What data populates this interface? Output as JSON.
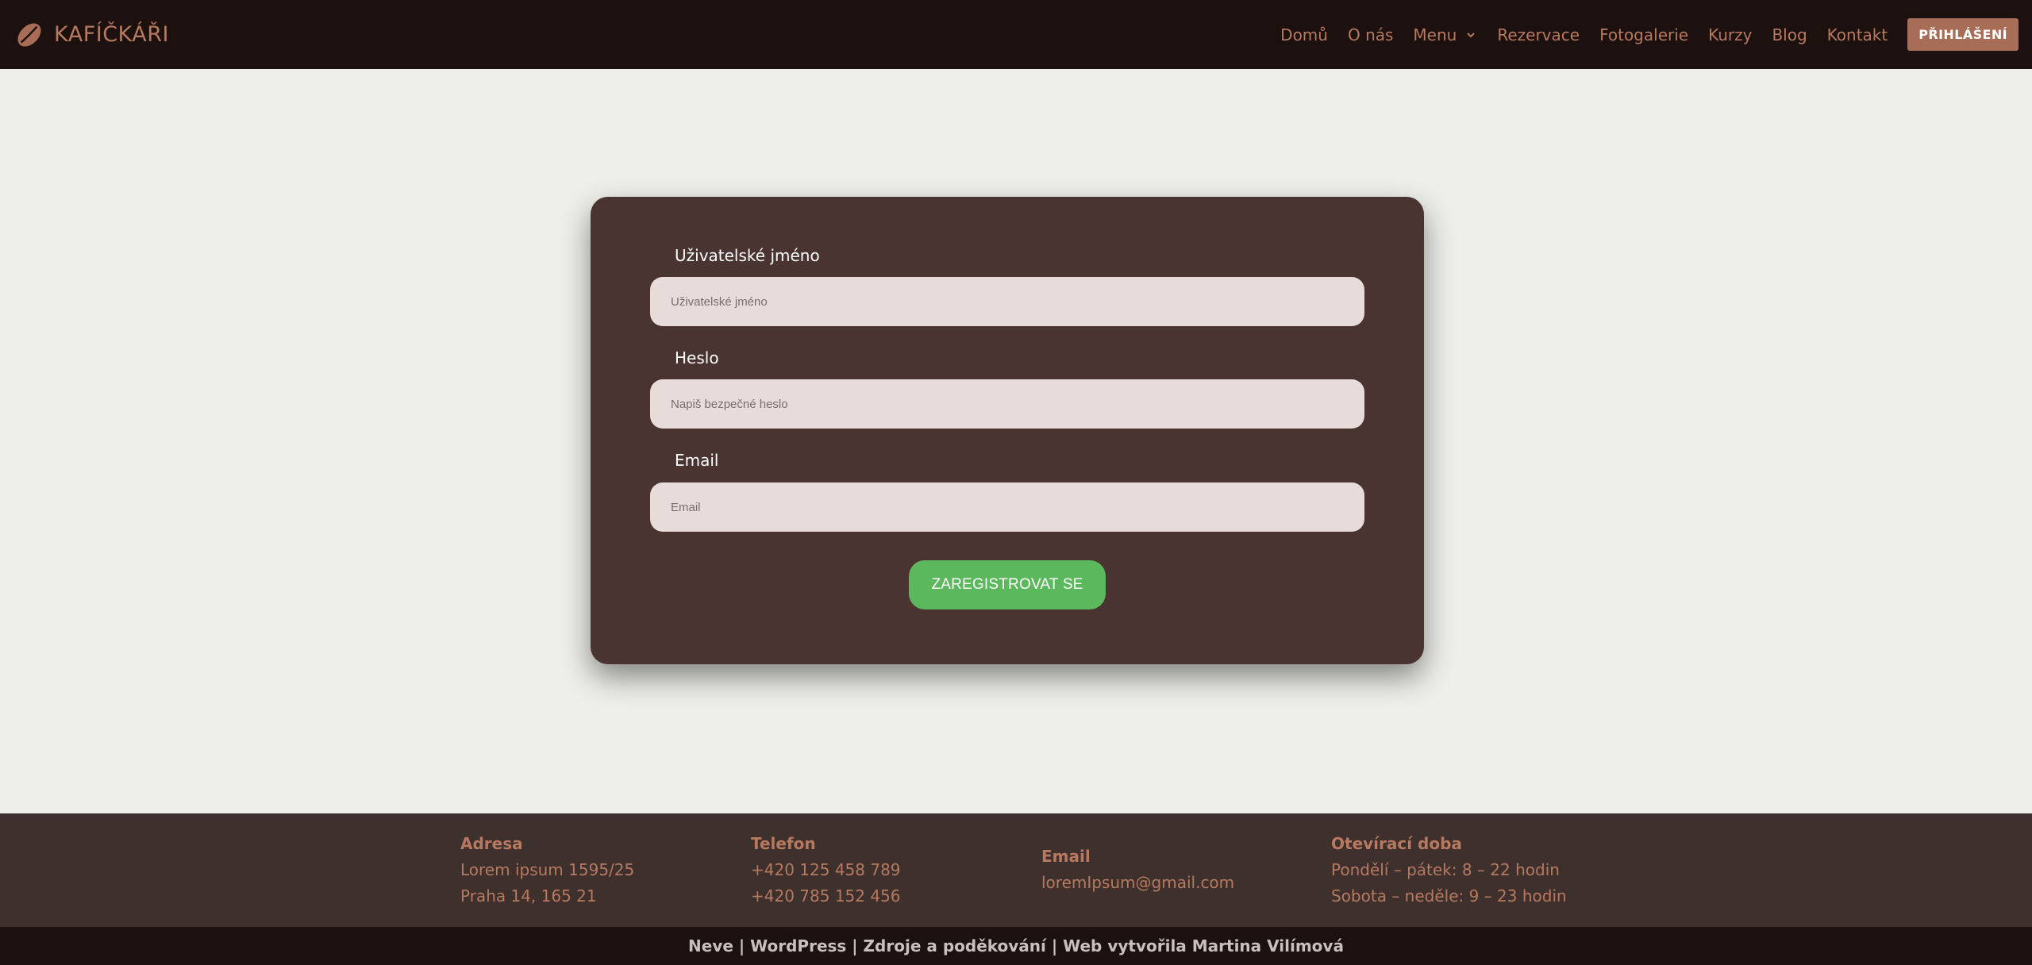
{
  "brand": {
    "name": "KAFÍČKÁŘI"
  },
  "nav": {
    "items": [
      "Domů",
      "O nás",
      "Menu",
      "Rezervace",
      "Fotogalerie",
      "Kurzy",
      "Blog",
      "Kontakt"
    ],
    "login_label": "PŘIHLÁŠENÍ"
  },
  "form": {
    "username_label": "Uživatelské jméno",
    "username_placeholder": "Uživatelské jméno",
    "password_label": "Heslo",
    "password_placeholder": "Napiš bezpečné heslo",
    "email_label": "Email",
    "email_placeholder": "Email",
    "submit_label": "ZAREGISTROVAT SE"
  },
  "footer": {
    "address_title": "Adresa",
    "address_line1": "Lorem ipsum 1595/25",
    "address_line2": "Praha 14, 165 21",
    "phone_title": "Telefon",
    "phone_line1": "+420 125 458 789",
    "phone_line2": "+420 785 152 456",
    "email_title": "Email",
    "email_value": "loremIpsum@gmail.com",
    "hours_title": "Otevírací doba",
    "hours_line1": "Pondělí – pátek: 8 – 22 hodin",
    "hours_line2": "Sobota – neděle: 9 – 23 hodin"
  },
  "bottom_bar": {
    "text": "Neve | WordPress | Zdroje a poděkování | Web vytvořila Martina Vilímová"
  },
  "colors": {
    "header_bg": "#1c110e",
    "accent": "#b7795f",
    "card_bg": "#4a3431",
    "submit_bg": "#5cb85c",
    "footer_bg": "#3e302d"
  },
  "icons": {
    "logo": "coffee-bean-icon",
    "menu_dropdown": "chevron-down-icon"
  }
}
